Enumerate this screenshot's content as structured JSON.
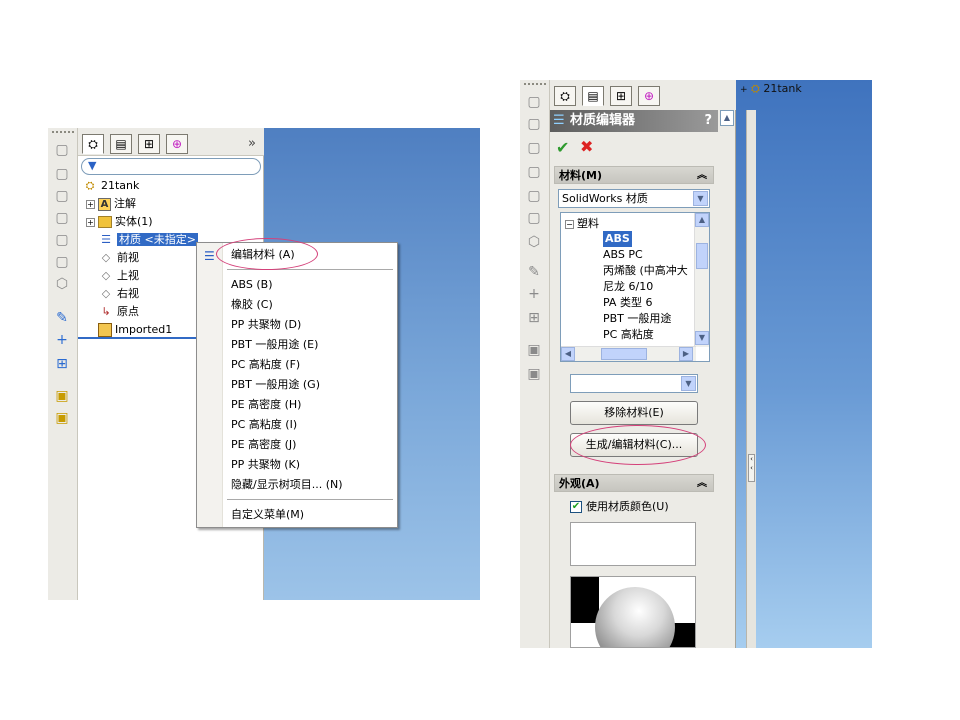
{
  "left_panel": {
    "tree": {
      "root": "21tank",
      "items": [
        {
          "label": "注解"
        },
        {
          "label": "实体(1)"
        },
        {
          "label": "材质 <未指定>"
        },
        {
          "label": "前视"
        },
        {
          "label": "上视"
        },
        {
          "label": "右视"
        },
        {
          "label": "原点"
        },
        {
          "label": "Imported1"
        }
      ]
    },
    "expand_label": "»",
    "context_menu": {
      "edit_material": "编辑材料 (A)",
      "items": [
        "ABS (B)",
        "橡胶 (C)",
        "PP 共聚物 (D)",
        "PBT 一般用途 (E)",
        "PC 高粘度 (F)",
        "PBT 一般用途 (G)",
        "PE 高密度 (H)",
        "PC 高粘度 (I)",
        "PE 高密度 (J)",
        "PP 共聚物 (K)",
        "隐藏/显示树项目... (N)"
      ],
      "customize": "自定义菜单(M)"
    }
  },
  "right_panel": {
    "title": "材质编辑器",
    "help": "?",
    "materials_group": "材料(M)",
    "library_value": "SolidWorks 材质",
    "category": "塑料",
    "materials_list": [
      "ABS",
      "ABS PC",
      "丙烯酸 (中高冲大",
      "尼龙 6/10",
      "PA 类型 6",
      "PBT 一般用途",
      "PC 高粘度"
    ],
    "selected_material": "ABS",
    "second_combo_value": "",
    "remove_button": "移除材料(E)",
    "edit_button": "生成/编辑材料(C)...",
    "appearance_group": "外观(A)",
    "use_material_color": "使用材质颜色(U)",
    "tree_root": "21tank"
  },
  "icons": {
    "feature_manager": "feature-tree-icon",
    "property_manager": "property-manager-icon",
    "configuration_manager": "configuration-manager-icon",
    "dimxpert": "crosshair-icon",
    "filter": "filter-icon",
    "ok": "check-icon",
    "cancel": "x-icon"
  },
  "colors": {
    "selection": "#316ac5",
    "annotation_circle": "#d4417a",
    "viewport_top": "#4f7fc1"
  }
}
